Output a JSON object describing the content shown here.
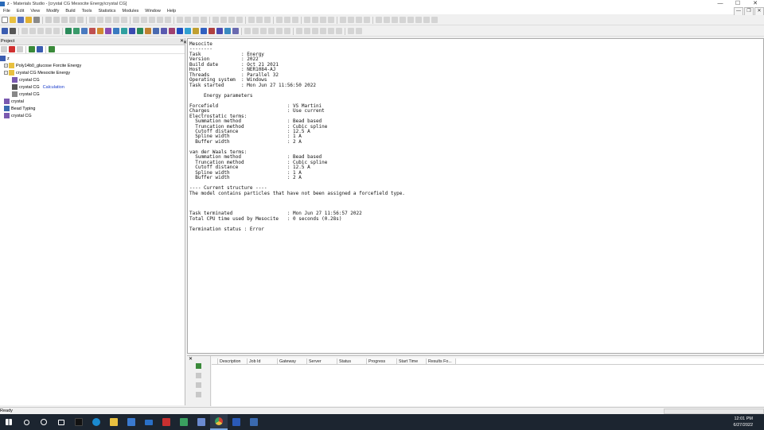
{
  "window": {
    "title": "z - Materials Studio - [crystal CG Mesocite Energy\\crystal CG]",
    "controls": [
      "—",
      "☐",
      "✕"
    ]
  },
  "menu": [
    "File",
    "Edit",
    "View",
    "Modify",
    "Build",
    "Tools",
    "Statistics",
    "Modules",
    "Window",
    "Help"
  ],
  "mdi_controls": [
    "—",
    "❐",
    "✕"
  ],
  "project": {
    "title": "Project",
    "close": "✕",
    "tree": [
      {
        "label": "z",
        "indent": 0,
        "icon": "project-icon",
        "expander": ""
      },
      {
        "label": "Poly14b0_glucose Forcite Energy",
        "indent": 1,
        "icon": "folder-icon",
        "expander": "+"
      },
      {
        "label": "crystal CG Mesocite Energy",
        "indent": 1,
        "icon": "folder-open-icon",
        "expander": "−"
      },
      {
        "label": "crystal CG",
        "indent": 3,
        "icon": "molecule-icon",
        "expander": "",
        "link": ""
      },
      {
        "label": "crystal CG",
        "indent": 3,
        "icon": "calculation-icon",
        "expander": "",
        "link": "Calculation"
      },
      {
        "label": "crystal CG",
        "indent": 3,
        "icon": "text-doc-icon",
        "expander": "",
        "link": ""
      },
      {
        "label": "crystal",
        "indent": 1,
        "icon": "molecule-icon",
        "expander": ""
      },
      {
        "label": "Bead Typing",
        "indent": 1,
        "icon": "grid-doc-icon",
        "expander": ""
      },
      {
        "label": "crystal CG",
        "indent": 1,
        "icon": "molecule-icon",
        "expander": ""
      }
    ]
  },
  "document": {
    "close": "✕",
    "lines": [
      "Mesocite",
      "--------",
      "Task              : Energy",
      "Version           : 2022",
      "Build date        : Oct 21 2021",
      "Host              : NER1084-AJ",
      "Threads           : Parallel 32",
      "Operating system  : Windows",
      "Task started      : Mon Jun 27 11:56:50 2022",
      "",
      "     Energy parameters",
      "",
      "Forcefield                        : VS Martini",
      "Charges                           : Use current",
      "Electrostatic terms:",
      "  Summation method                : Bead based",
      "  Truncation method               : Cubic spline",
      "  Cutoff distance                 : 12.5 A",
      "  Spline width                    : 1 A",
      "  Buffer width                    : 2 A",
      "",
      "van der Waals terms:",
      "  Summation method                : Bead based",
      "  Truncation method               : Cubic spline",
      "  Cutoff distance                 : 12.5 A",
      "  Spline width                    : 1 A",
      "  Buffer width                    : 2 A",
      "",
      "---- Current structure ----",
      "The model contains particles that have not been assigned a forcefield type.",
      "",
      "",
      "",
      "Task terminated                   : Mon Jun 27 11:56:57 2022",
      "Total CPU time used by Mesocite   : 0 seconds (0.28s)",
      "",
      "Termination status : Error"
    ]
  },
  "jobs": {
    "close": "✕",
    "columns": [
      "",
      "Description",
      "Job Id",
      "Gateway",
      "Server",
      "Status",
      "Progress",
      "Start Time",
      "Results Fo..."
    ]
  },
  "status": {
    "text": "Ready"
  },
  "taskbar": {
    "time": "12:01 PM",
    "date": "6/27/2022",
    "apps": [
      "start",
      "search",
      "cortana",
      "task-view",
      "materials-studio",
      "edge",
      "file-explorer",
      "store",
      "mail",
      "app-red",
      "app-green",
      "app-blue",
      "chrome",
      "word",
      "app-window"
    ]
  },
  "colors": {
    "taskbar": "#1c2530",
    "link": "#1a3ccc",
    "accent": "#2a6ab8"
  }
}
